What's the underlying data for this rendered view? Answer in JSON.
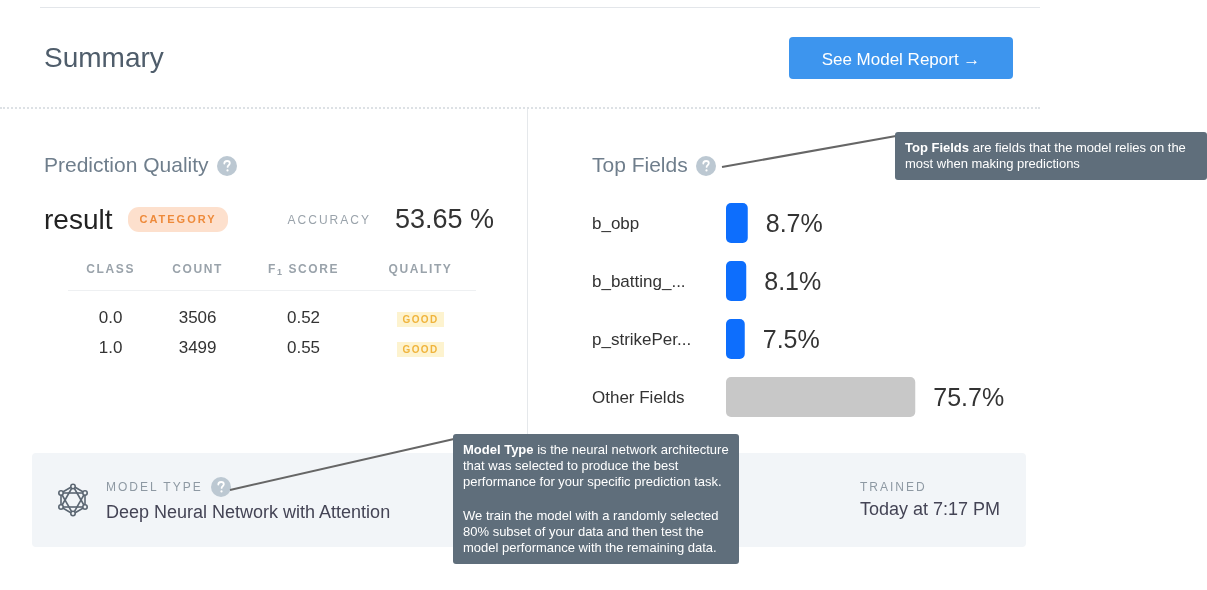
{
  "header": {
    "title": "Summary",
    "report_button": "See Model Report →"
  },
  "prediction_quality": {
    "title": "Prediction Quality",
    "target": "result",
    "target_type": "CATEGORY",
    "accuracy_label": "ACCURACY",
    "accuracy": "53.65 %",
    "columns": [
      "CLASS",
      "COUNT",
      "F$_{1}$ SCORE",
      "QUALITY"
    ],
    "rows": [
      {
        "class": "0.0",
        "count": "3506",
        "f1": "0.52",
        "quality": "GOOD"
      },
      {
        "class": "1.0",
        "count": "3499",
        "f1": "0.55",
        "quality": "GOOD"
      }
    ]
  },
  "top_fields": {
    "title": "Top Fields",
    "chart_data": {
      "type": "bar",
      "orientation": "horizontal",
      "categories": [
        "b_obp",
        "b_batting_...",
        "p_strikePer...",
        "Other Fields"
      ],
      "series": [
        {
          "color": "#0d6efd",
          "values": [
            8.7,
            8.1,
            7.5,
            null
          ],
          "value_labels": [
            "8.7%",
            "8.1%",
            "7.5%",
            null
          ]
        },
        {
          "color": "#c8c8c8",
          "values": [
            null,
            null,
            null,
            75.7
          ],
          "value_labels": [
            null,
            null,
            null,
            "75.7%"
          ]
        }
      ]
    }
  },
  "model": {
    "type_label": "MODEL TYPE",
    "type": "Deep Neural Network with Attention",
    "trained_label": "TRAINED",
    "trained": "Today at 7:17 PM"
  },
  "tooltips": [
    {
      "paragraphs": [
        "**Top Fields** are fields that the model relies on the most when making predictions"
      ]
    },
    {
      "paragraphs": [
        "**Model Type** is the neural network architecture that was selected to produce the best performance for your specific prediction task.",
        "We train the model with a randomly selected 80% subset of your data and then test the model performance with the remaining data."
      ]
    }
  ]
}
